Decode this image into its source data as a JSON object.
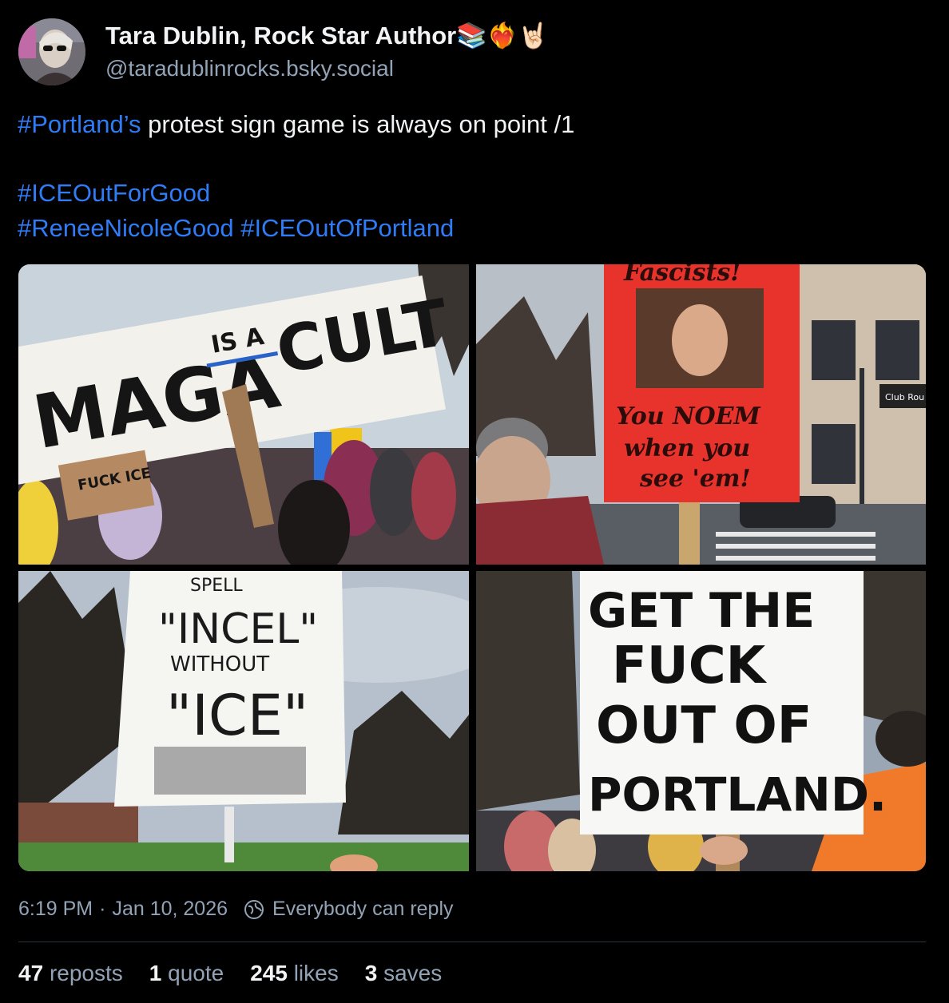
{
  "author": {
    "display_name": "Tara Dublin, Rock Star Author📚❤️‍🔥🤘🏻",
    "handle": "@taradublinrocks.bsky.social",
    "avatar_icon": "avatar-photo"
  },
  "post": {
    "line1_tag": "#Portland’s",
    "line1_text": " protest sign game is always on point /1",
    "tag_ice_out_for_good": "#ICEOutForGood",
    "tag_renee": "#ReneeNicoleGood",
    "tag_ice_out_of_portland": "#ICEOutOfPortland"
  },
  "images": [
    {
      "sign_text_1": "MAGA",
      "sign_text_2": "IS A",
      "sign_text_3": "CULT",
      "sign_text_4": "FUCK ICE"
    },
    {
      "sign_text_1": "You NOEM",
      "sign_text_2": "when you",
      "sign_text_3": "see 'em!",
      "sign_text_4": "Fascists!",
      "shop_text": "Club Rou"
    },
    {
      "sign_text_1": "SPELL",
      "sign_text_2": "\"INCEL\"",
      "sign_text_3": "WITHOUT",
      "sign_text_4": "\"ICE\""
    },
    {
      "sign_text_1": "GET THE",
      "sign_text_2": "FUCK",
      "sign_text_3": "OUT OF",
      "sign_text_4": "PORTLAND."
    }
  ],
  "meta": {
    "time": "6:19 PM",
    "separator": "·",
    "date": "Jan 10, 2026",
    "reply_setting": "Everybody can reply",
    "reply_icon": "globe-icon"
  },
  "stats": {
    "reposts_count": "47",
    "reposts_label": "reposts",
    "quotes_count": "1",
    "quotes_label": "quote",
    "likes_count": "245",
    "likes_label": "likes",
    "saves_count": "3",
    "saves_label": "saves"
  },
  "colors": {
    "background": "#000000",
    "text": "#f1f3f5",
    "muted": "#93a3b6",
    "link": "#2f7cf6"
  }
}
